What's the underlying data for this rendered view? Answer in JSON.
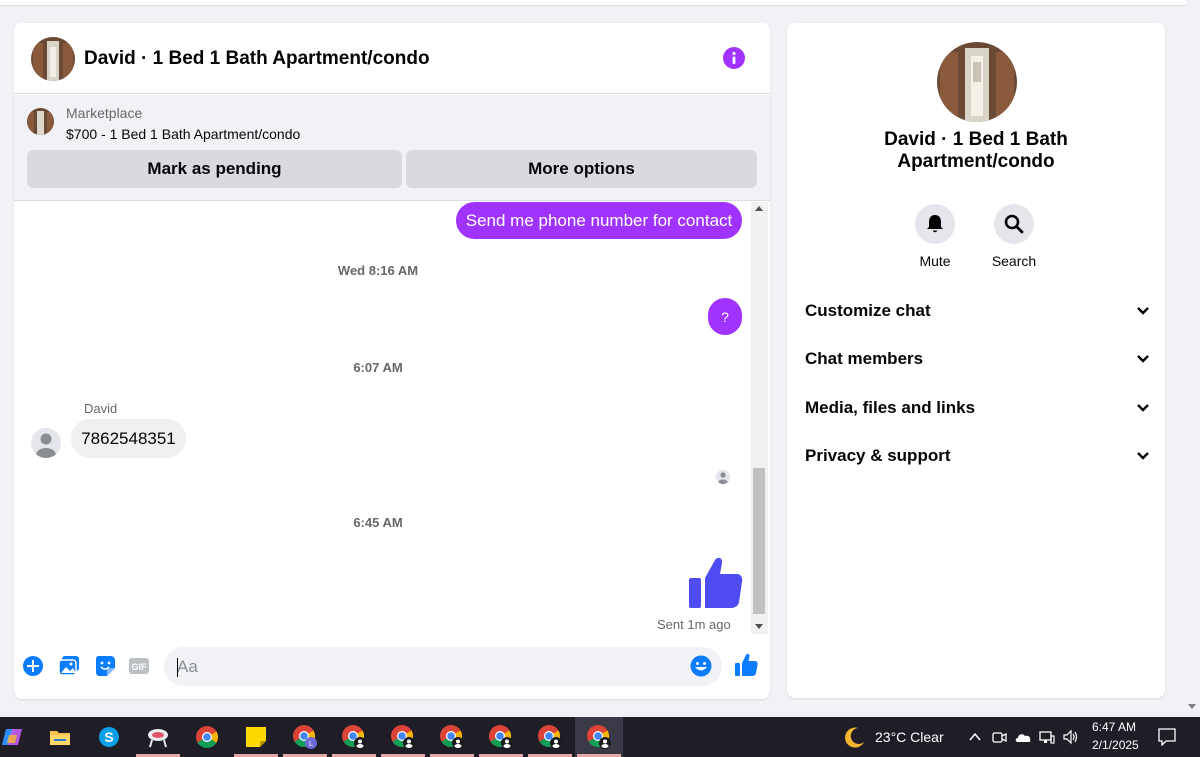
{
  "chat": {
    "title": "David · 1 Bed 1 Bath Apartment/condo",
    "listing": {
      "source": "Marketplace",
      "price_title": "$700 - 1 Bed 1 Bath Apartment/condo",
      "mark_pending": "Mark as pending",
      "more_options": "More options"
    },
    "messages": {
      "out1": "Send me phone number for contact",
      "ts1": "Wed 8:16 AM",
      "out2": "?",
      "ts2": "6:07 AM",
      "sender": "David",
      "in1": "7862548351",
      "ts3": "6:45 AM",
      "status": "Sent 1m ago"
    },
    "composer": {
      "placeholder": "Aa"
    },
    "accent": "#a033ff",
    "like_color": "#4e4cf2"
  },
  "side": {
    "name": "David · 1 Bed 1 Bath Apartment/condo",
    "actions": {
      "mute": "Mute",
      "search": "Search"
    },
    "sections": [
      "Customize chat",
      "Chat members",
      "Media, files and links",
      "Privacy & support"
    ]
  },
  "taskbar": {
    "weather": "23°C  Clear",
    "time": "6:47 AM",
    "date": "2/1/2025"
  }
}
